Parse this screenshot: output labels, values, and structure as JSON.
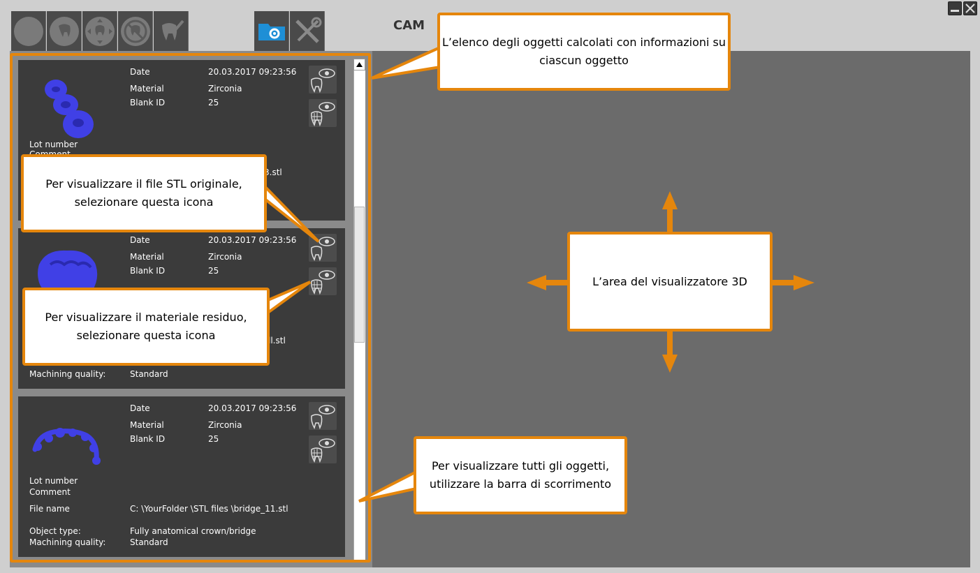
{
  "app": {
    "title": "CAM"
  },
  "colors": {
    "accent": "#e5860c",
    "mesh": "#4040e6",
    "panel": "#3b3b3b",
    "viewer": "#6b6b6b"
  },
  "toolbar": {
    "buttons": [
      {
        "icon": "circle-icon"
      },
      {
        "icon": "tooth-icon"
      },
      {
        "icon": "tooth-move-icon"
      },
      {
        "icon": "tooth-blocked-icon"
      },
      {
        "icon": "tooth-edit-icon"
      },
      {
        "icon": "folder-gear-icon"
      },
      {
        "icon": "tools-icon"
      }
    ]
  },
  "window_controls": {
    "minimize_icon": "minimize-icon",
    "close_icon": "close-icon"
  },
  "objects": [
    {
      "date_label": "Date",
      "date": "20.03.2017 09:23:56",
      "material_label": "Material",
      "material": "Zirconia",
      "blank_label": "Blank ID",
      "blank": "25",
      "lot_label": "Lot number",
      "comment_label": "Comment",
      "file_fragment": "3.stl"
    },
    {
      "date_label": "Date",
      "date": "20.03.2017 09:23:56",
      "material_label": "Material",
      "material": "Zirconia",
      "blank_label": "Blank ID",
      "blank": "25",
      "file_fragment": "ll.stl",
      "quality_label": "Machining quality:",
      "quality": "Standard"
    },
    {
      "date_label": "Date",
      "date": "20.03.2017 09:23:56",
      "material_label": "Material",
      "material": "Zirconia",
      "blank_label": "Blank ID",
      "blank": "25",
      "lot_label": "Lot number",
      "comment_label": "Comment",
      "file_label": "File name",
      "file": "C: \\YourFolder \\STL files \\bridge_11.stl",
      "type_label": "Object type:",
      "type": "Fully anatomical crown/bridge",
      "quality_label": "Machining quality:",
      "quality": "Standard"
    }
  ],
  "callouts": {
    "list": {
      "line1": "L’elenco degli oggetti calcolati con informazioni su",
      "line2": "ciascun oggetto"
    },
    "stl": {
      "line1": "Per visualizzare il file STL originale,",
      "line2": "selezionare questa icona"
    },
    "residual": {
      "line1": "Per visualizzare il materiale residuo,",
      "line2": "selezionare questa icona"
    },
    "scroll": {
      "line1": "Per visualizzare tutti gli oggetti,",
      "line2": "utilizzare la barra di scorrimento"
    },
    "viewer": {
      "line1": "L’area del visualizzatore 3D"
    }
  }
}
